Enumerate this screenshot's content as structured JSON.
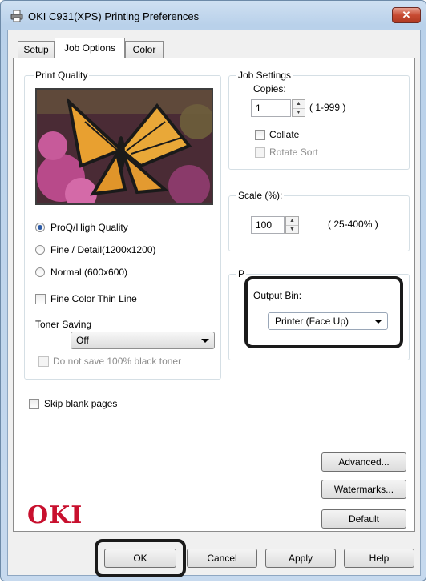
{
  "window": {
    "title": "OKI C931(XPS) Printing Preferences",
    "close_symbol": "✕"
  },
  "tabs": [
    {
      "label": "Setup"
    },
    {
      "label": "Job Options"
    },
    {
      "label": "Color"
    }
  ],
  "print_quality": {
    "legend": "Print Quality",
    "options": [
      {
        "label": "ProQ/High Quality",
        "selected": true
      },
      {
        "label": "Fine / Detail(1200x1200)",
        "selected": false
      },
      {
        "label": "Normal (600x600)",
        "selected": false
      }
    ],
    "fine_color_thin_line": "Fine Color Thin Line",
    "toner_saving_label": "Toner Saving",
    "toner_saving_value": "Off",
    "no_black_toner": "Do not save 100% black toner"
  },
  "job_settings": {
    "legend": "Job Settings",
    "copies_label": "Copies:",
    "copies_value": "1",
    "copies_range": "( 1-999 )",
    "collate": "Collate",
    "rotate_sort": "Rotate Sort"
  },
  "scale": {
    "legend": "Scale (%):",
    "value": "100",
    "range": "( 25-400% )"
  },
  "output": {
    "legend_fragment": "P",
    "bin_label": "Output Bin:",
    "bin_value": "Printer (Face Up)"
  },
  "skip_blank_pages": "Skip blank pages",
  "side_buttons": {
    "advanced": "Advanced...",
    "watermarks": "Watermarks...",
    "default": "Default"
  },
  "logo_text": "OKI",
  "footer": {
    "ok": "OK",
    "cancel": "Cancel",
    "apply": "Apply",
    "help": "Help"
  },
  "colors": {
    "logo": "#c8102e",
    "close_button": "#c74a32",
    "radio_selected": "#2b5aa6"
  },
  "icons": [
    "printer-icon",
    "close-icon",
    "spin-up-icon",
    "spin-down-icon",
    "dropdown-arrow-icon"
  ]
}
